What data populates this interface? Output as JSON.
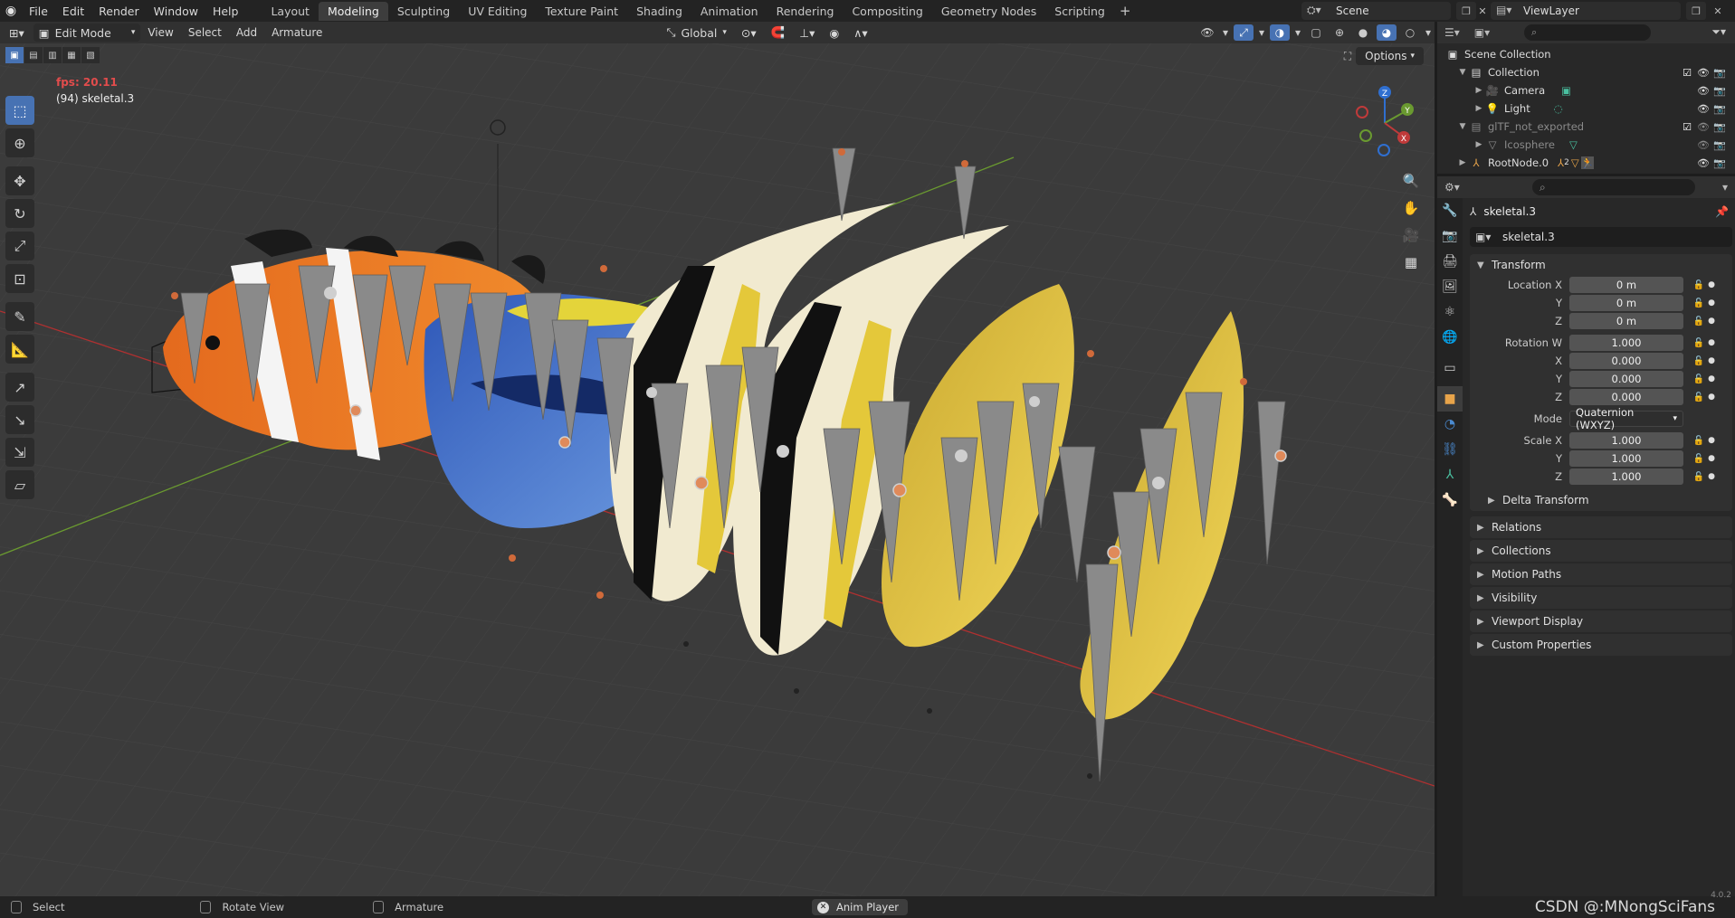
{
  "topbar": {
    "menu": [
      "File",
      "Edit",
      "Render",
      "Window",
      "Help"
    ],
    "workspaces": [
      "Layout",
      "Modeling",
      "Sculpting",
      "UV Editing",
      "Texture Paint",
      "Shading",
      "Animation",
      "Rendering",
      "Compositing",
      "Geometry Nodes",
      "Scripting"
    ],
    "active_workspace": "Modeling",
    "scene": "Scene",
    "view_layer": "ViewLayer"
  },
  "viewport": {
    "mode": "Edit Mode",
    "menu": [
      "View",
      "Select",
      "Add",
      "Armature"
    ],
    "orientation": "Global",
    "options_label": "Options",
    "fps": "fps: 20.11",
    "object_info": "(94) skeletal.3",
    "gizmo": {
      "z": "Z",
      "y": "Y",
      "x": "X"
    },
    "colors": {
      "background": "#3b3b3b",
      "x_axis": "#b03030",
      "y_axis": "#6a9a30",
      "accent": "#4772b3"
    }
  },
  "outliner": {
    "search_placeholder": "",
    "rows": [
      {
        "label": "Scene Collection",
        "icon": "scene-collection-icon",
        "indent": 0
      },
      {
        "label": "Collection",
        "icon": "collection-icon",
        "indent": 1
      },
      {
        "label": "Camera",
        "icon": "camera-icon",
        "indent": 2
      },
      {
        "label": "Light",
        "icon": "light-icon",
        "indent": 2
      },
      {
        "label": "glTF_not_exported",
        "icon": "collection-icon",
        "indent": 1,
        "dim": true
      },
      {
        "label": "Icosphere",
        "icon": "mesh-icon",
        "indent": 2,
        "dim": true
      },
      {
        "label": "RootNode.0",
        "icon": "empty-icon",
        "indent": 1,
        "badge": "2"
      }
    ]
  },
  "properties": {
    "object_name": "skeletal.3",
    "data_name": "skeletal.3",
    "transform_label": "Transform",
    "location": {
      "label": "Location X",
      "x": "0 m",
      "y": "0 m",
      "z": "0 m"
    },
    "rotation": {
      "label": "Rotation W",
      "w": "1.000",
      "x": "0.000",
      "y": "0.000",
      "z": "0.000"
    },
    "mode": {
      "label": "Mode",
      "value": "Quaternion (WXYZ)"
    },
    "scale": {
      "label": "Scale X",
      "x": "1.000",
      "y": "1.000",
      "z": "1.000"
    },
    "axis_labels": {
      "x": "X",
      "y": "Y",
      "z": "Z"
    },
    "delta_transform": "Delta Transform",
    "panels": [
      "Relations",
      "Collections",
      "Motion Paths",
      "Visibility",
      "Viewport Display",
      "Custom Properties"
    ]
  },
  "statusbar": {
    "select": "Select",
    "rotate": "Rotate View",
    "armature": "Armature",
    "anim_player": "Anim Player",
    "watermark": "CSDN @:MNongSciFans",
    "version": "4.0.2"
  }
}
